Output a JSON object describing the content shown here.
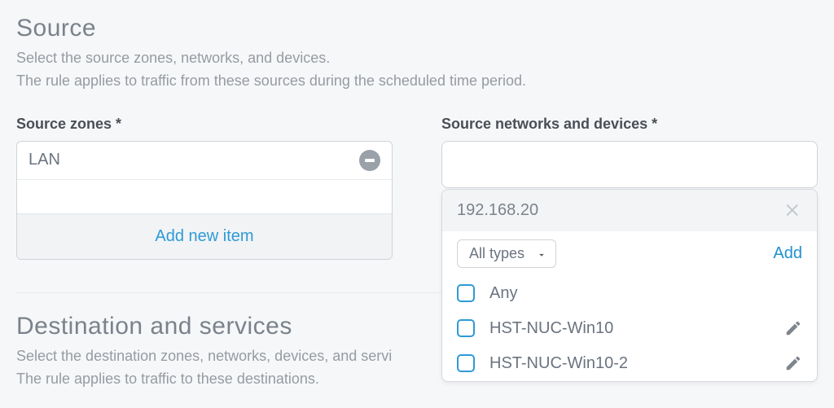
{
  "source": {
    "title": "Source",
    "desc_line1": "Select the source zones, networks, and devices.",
    "desc_line2": "The rule applies to traffic from these sources during the scheduled time period.",
    "zones_label": "Source zones *",
    "zone_items": [
      "LAN"
    ],
    "add_item_label": "Add new item",
    "networks_label": "Source networks and devices *"
  },
  "dropdown": {
    "search_text": "192.168.20",
    "type_filter": "All types",
    "add_label": "Add",
    "options": [
      {
        "label": "Any",
        "editable": false
      },
      {
        "label": "HST-NUC-Win10",
        "editable": true
      },
      {
        "label": "HST-NUC-Win10-2",
        "editable": true
      }
    ]
  },
  "destination": {
    "title": "Destination and services",
    "desc_line1": "Select the destination zones, networks, devices, and servi",
    "desc_line2": "The rule applies to traffic to these destinations."
  }
}
